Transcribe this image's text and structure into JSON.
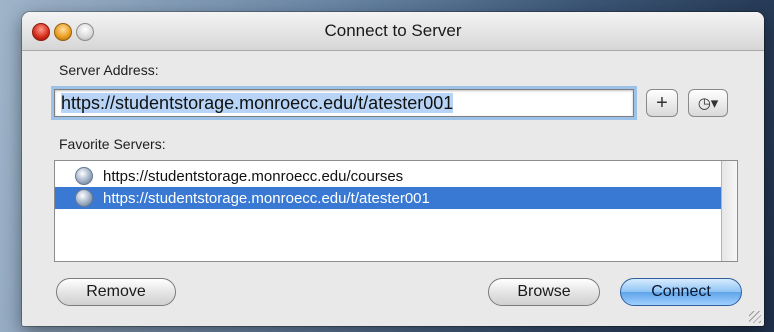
{
  "window": {
    "title": "Connect to Server"
  },
  "server_address": {
    "label": "Server Address:",
    "value": "https://studentstorage.monroecc.edu/t/atester001"
  },
  "buttons": {
    "add_favorite_icon": "plus-icon",
    "recent_servers_icon": "clock-icon",
    "add_favorite_glyph": "+",
    "recent_servers_glyph": "◷▾",
    "remove": "Remove",
    "browse": "Browse",
    "connect": "Connect"
  },
  "favorites": {
    "label": "Favorite Servers:",
    "items": [
      {
        "url": "https://studentstorage.monroecc.edu/courses",
        "selected": false
      },
      {
        "url": "https://studentstorage.monroecc.edu/t/atester001",
        "selected": true
      }
    ]
  },
  "colors": {
    "selection": "#3979d3",
    "focus_ring": "#9cc2ea",
    "default_button": "#5fa4e8"
  }
}
